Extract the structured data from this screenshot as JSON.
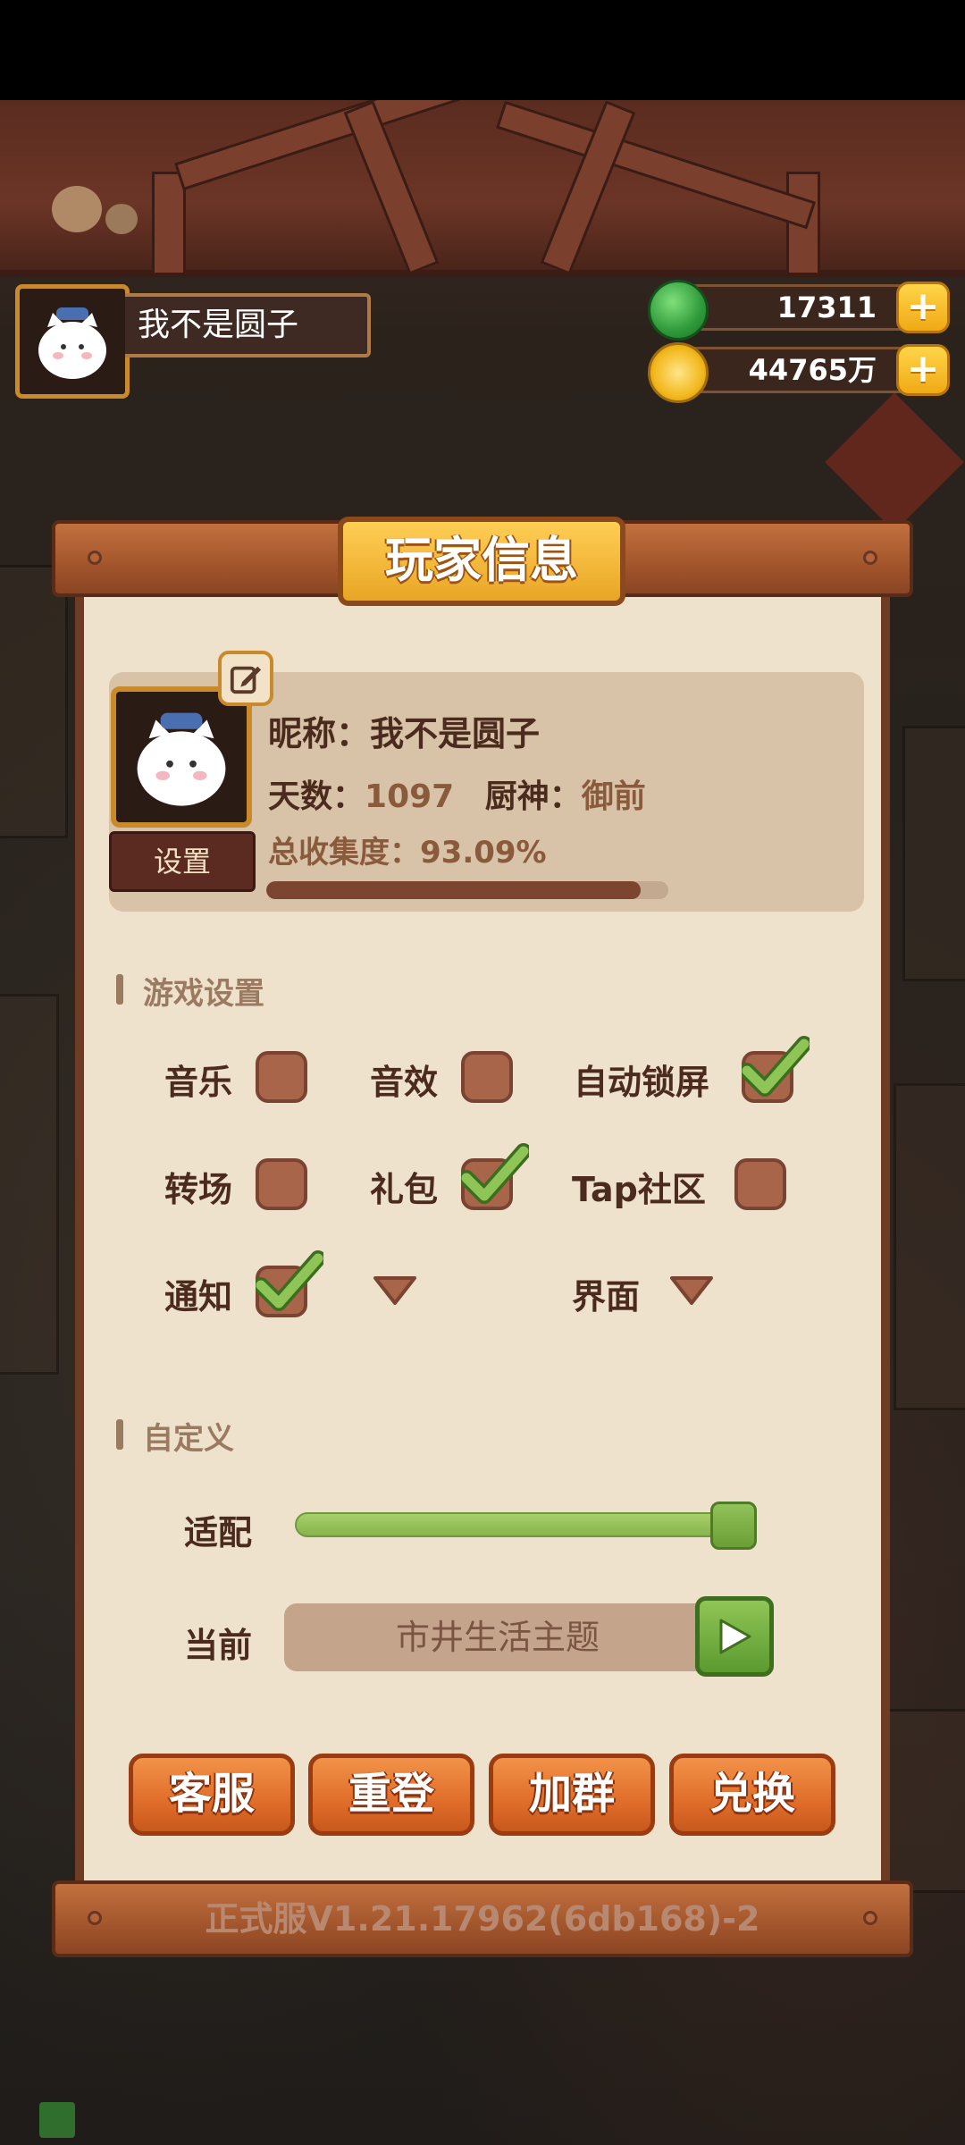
{
  "player": {
    "name": "我不是圆子"
  },
  "currency": {
    "jade": "17311",
    "coins": "44765万"
  },
  "panel": {
    "title": "玩家信息",
    "settings_label": "设置",
    "nickname_label": "昵称：",
    "nickname": "我不是圆子",
    "days_label": "天数：",
    "days": "1097",
    "chef_label": "厨神：",
    "chef_rank": "御前",
    "collection_label": "总收集度：",
    "collection": "93.09%",
    "collection_fraction": 0.9309
  },
  "game_settings": {
    "title": "游戏设置",
    "options": [
      {
        "label": "音乐",
        "checked": false
      },
      {
        "label": "音效",
        "checked": false
      },
      {
        "label": "自动锁屏",
        "checked": true
      },
      {
        "label": "转场",
        "checked": false
      },
      {
        "label": "礼包",
        "checked": true
      },
      {
        "label": "Tap社区",
        "checked": false
      },
      {
        "label": "通知",
        "checked": true
      },
      {
        "label": "界面",
        "checked": null
      }
    ]
  },
  "custom": {
    "title": "自定义",
    "adapt_label": "适配",
    "adapt_value": 1.0,
    "current_label": "当前",
    "current_theme": "市井生活主题"
  },
  "actions": [
    "客服",
    "重登",
    "加群",
    "兑换"
  ],
  "version": "正式服V1.21.17962(6db168)-2",
  "colors": {
    "panel_bg": "#efe2cc",
    "wood": "#6e3b23",
    "orange_button": "#e06d2a",
    "gold": "#f0a915",
    "green": "#86b44b"
  }
}
